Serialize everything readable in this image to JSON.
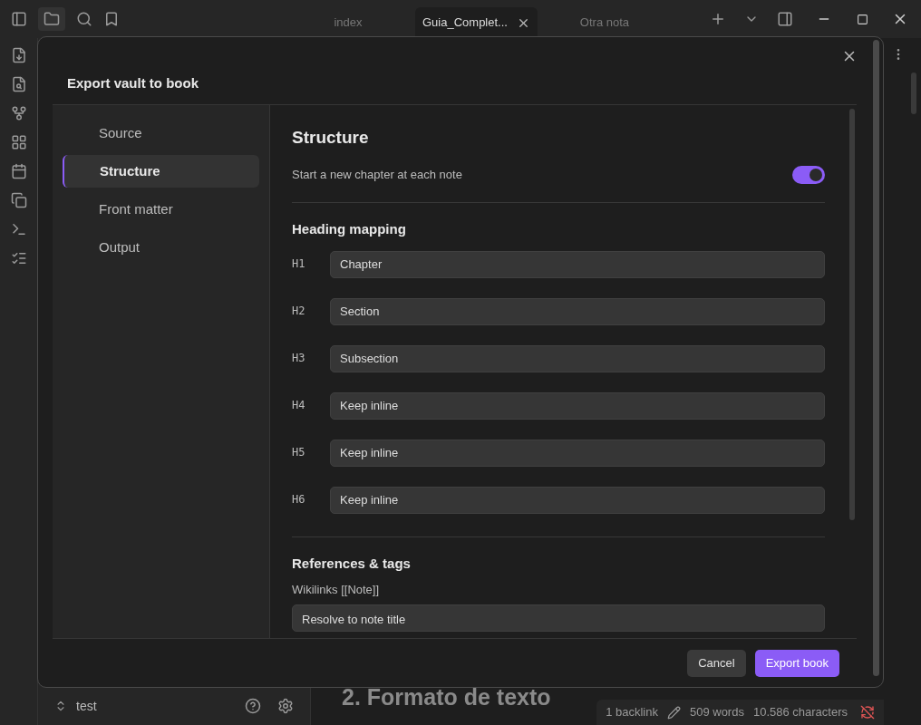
{
  "tabs": [
    {
      "label": "index",
      "selected": false
    },
    {
      "label": "Guia_Complet...",
      "selected": true
    },
    {
      "label": "Otra nota",
      "selected": false
    }
  ],
  "modal": {
    "title": "Export vault to book",
    "nav": [
      {
        "label": "Source",
        "selected": false
      },
      {
        "label": "Structure",
        "selected": true
      },
      {
        "label": "Front matter",
        "selected": false
      },
      {
        "label": "Output",
        "selected": false
      }
    ],
    "section_title": "Structure",
    "toggle": {
      "label": "Start a new chapter at each note",
      "on": true
    },
    "heading_mapping": {
      "title": "Heading mapping",
      "rows": [
        {
          "level": "H1",
          "value": "Chapter"
        },
        {
          "level": "H2",
          "value": "Section"
        },
        {
          "level": "H3",
          "value": "Subsection"
        },
        {
          "level": "H4",
          "value": "Keep inline"
        },
        {
          "level": "H5",
          "value": "Keep inline"
        },
        {
          "level": "H6",
          "value": "Keep inline"
        }
      ]
    },
    "references": {
      "title": "References & tags",
      "wikilinks_label": "Wikilinks [[Note]]",
      "wikilinks_value": "Resolve to note title"
    },
    "buttons": [
      {
        "label": "Cancel",
        "kind": "secondary"
      },
      {
        "label": "Export book",
        "kind": "primary"
      }
    ]
  },
  "vault": {
    "name": "test"
  },
  "note_heading": "2. Formato de texto",
  "status_bar": {
    "backlinks": "1 backlink",
    "words": "509 words",
    "characters": "10.586 characters"
  }
}
